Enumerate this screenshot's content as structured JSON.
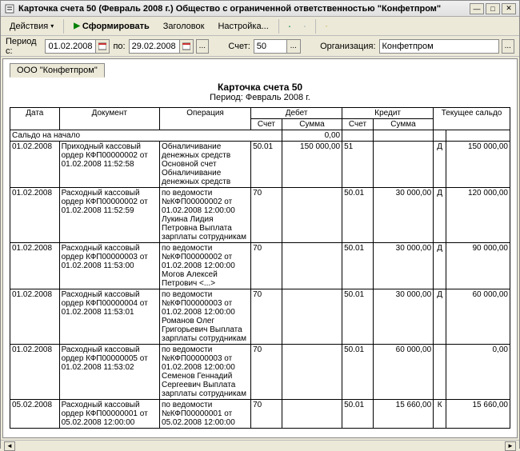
{
  "window": {
    "title": "Карточка счета 50 (Февраль 2008 г.) Общество с ограниченной ответственностью \"Конфетпром\""
  },
  "toolbar": {
    "actions": "Действия",
    "generate": "Сформировать",
    "header": "Заголовок",
    "settings": "Настройка..."
  },
  "filters": {
    "period_from_label": "Период с:",
    "period_from": "01.02.2008",
    "period_to_label": "по:",
    "period_to": "29.02.2008",
    "ellipsis": "...",
    "account_label": "Счет:",
    "account": "50",
    "org_label": "Организация:",
    "org": "Конфетпром"
  },
  "tab": {
    "label": "ООО \"Конфетпром\""
  },
  "report": {
    "title": "Карточка счета 50",
    "subtitle": "Период: Февраль 2008 г."
  },
  "headers": {
    "date": "Дата",
    "doc": "Документ",
    "op": "Операция",
    "debit": "Дебет",
    "credit": "Кредит",
    "balance": "Текущее сальдо",
    "acct": "Счет",
    "sum": "Сумма"
  },
  "start_row": {
    "label": "Сальдо на начало",
    "sum": "0,00"
  },
  "rows": [
    {
      "date": "01.02.2008",
      "doc": "Приходный кассовый ордер КФП00000002 от 01.02.2008 11:52:58",
      "op": "Обналичивание денежных средств Основной счет Обналичивание денежных средств",
      "d_acct": "50.01",
      "d_sum": "150 000,00",
      "c_acct": "51",
      "c_sum": "",
      "bal_side": "Д",
      "bal_sum": "150 000,00"
    },
    {
      "date": "01.02.2008",
      "doc": "Расходный кассовый ордер КФП00000002 от 01.02.2008 11:52:59",
      "op": "по ведомости №КФП00000002 от 01.02.2008 12:00:00 Лукина Лидия Петровна Выплата зарплаты сотрудникам",
      "d_acct": "70",
      "d_sum": "",
      "c_acct": "50.01",
      "c_sum": "30 000,00",
      "bal_side": "Д",
      "bal_sum": "120 000,00"
    },
    {
      "date": "01.02.2008",
      "doc": "Расходный кассовый ордер КФП00000003 от 01.02.2008 11:53:00",
      "op": "по ведомости №КФП00000002 от 01.02.2008 12:00:00 Могов Алексей Петрович <...>",
      "d_acct": "70",
      "d_sum": "",
      "c_acct": "50.01",
      "c_sum": "30 000,00",
      "bal_side": "Д",
      "bal_sum": "90 000,00"
    },
    {
      "date": "01.02.2008",
      "doc": "Расходный кассовый ордер КФП00000004 от 01.02.2008 11:53:01",
      "op": "по ведомости №КФП00000003 от 01.02.2008 12:00:00 Романов Олег Григорьевич Выплата зарплаты сотрудникам",
      "d_acct": "70",
      "d_sum": "",
      "c_acct": "50.01",
      "c_sum": "30 000,00",
      "bal_side": "Д",
      "bal_sum": "60 000,00"
    },
    {
      "date": "01.02.2008",
      "doc": "Расходный кассовый ордер КФП00000005 от 01.02.2008 11:53:02",
      "op": "по ведомости №КФП00000003 от 01.02.2008 12:00:00 Семенов Геннадий Сергеевич Выплата зарплаты сотрудникам",
      "d_acct": "70",
      "d_sum": "",
      "c_acct": "50.01",
      "c_sum": "60 000,00",
      "bal_side": "",
      "bal_sum": "0,00"
    },
    {
      "date": "05.02.2008",
      "doc": "Расходный кассовый ордер КФП00000001 от 05.02.2008 12:00:00",
      "op": "по ведомости №КФП00000001 от 05.02.2008 12:00:00",
      "d_acct": "70",
      "d_sum": "",
      "c_acct": "50.01",
      "c_sum": "15 660,00",
      "bal_side": "К",
      "bal_sum": "15 660,00"
    }
  ]
}
